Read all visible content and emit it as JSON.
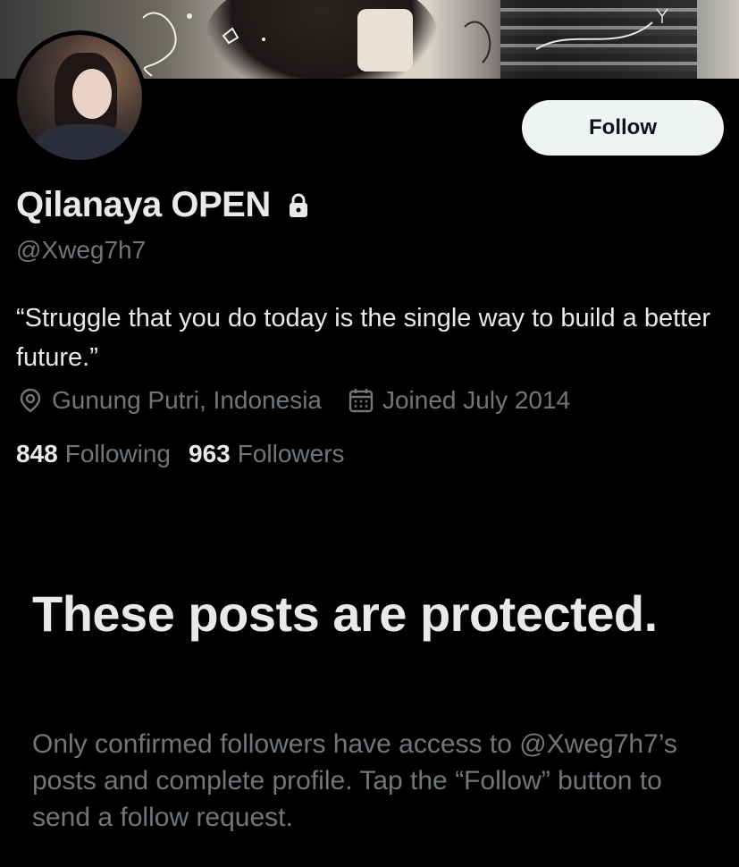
{
  "profile": {
    "display_name": "Qilanaya OPEN",
    "handle": "@Xweg7h7",
    "bio": "“Struggle that you do today is the single way to build a better future.”",
    "location": "Gunung Putri, Indonesia",
    "joined": "Joined July 2014",
    "following_count": "848",
    "following_label": "Following",
    "followers_count": "963",
    "followers_label": "Followers",
    "protected": true
  },
  "actions": {
    "follow_label": "Follow"
  },
  "protected_notice": {
    "title": "These posts are protected.",
    "description": "Only confirmed followers have access to @Xweg7h7’s posts and complete profile. Tap the “Follow” button to send a follow request."
  },
  "icons": {
    "lock": "lock-icon",
    "location": "location-pin-icon",
    "calendar": "calendar-icon"
  },
  "colors": {
    "background": "#000000",
    "primary_text": "#e7e9ea",
    "secondary_text": "#71767b",
    "follow_button_bg": "#eff3f4",
    "follow_button_text": "#0f1419"
  }
}
